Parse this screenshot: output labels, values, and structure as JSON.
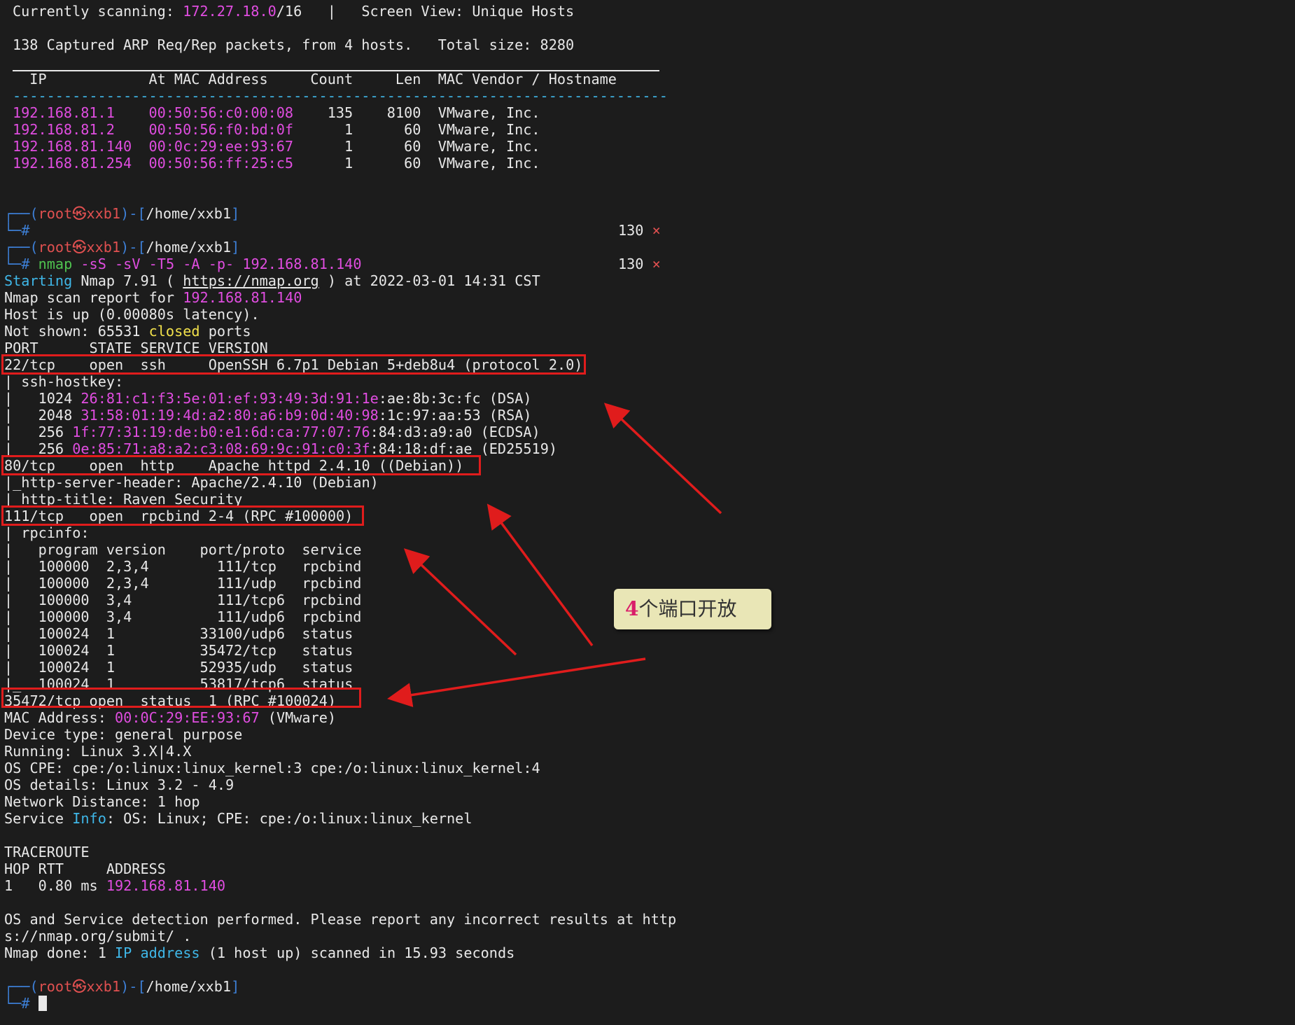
{
  "scan_header": {
    "scanning_label": "Currently scanning: ",
    "scanning_range_ip": "172.27.18.0",
    "scanning_range_mask": "/16",
    "separator": "   |   ",
    "screen_view": "Screen View: Unique Hosts",
    "captured": "138 Captured ARP Req/Rep packets, from 4 hosts.   Total size: 8280"
  },
  "hosts_table": {
    "header": "  IP            At MAC Address     Count     Len  MAC Vendor / Hostname",
    "dashes": "-----------------------------------------------------------------------------",
    "rows": [
      {
        "ip": "192.168.81.1  ",
        "mac": "00:50:56:c0:00:08",
        "rest": "    135    8100  VMware, Inc."
      },
      {
        "ip": "192.168.81.2  ",
        "mac": "00:50:56:f0:bd:0f",
        "rest": "      1      60  VMware, Inc."
      },
      {
        "ip": "192.168.81.140",
        "mac": "00:0c:29:ee:93:67",
        "rest": "      1      60  VMware, Inc."
      },
      {
        "ip": "192.168.81.254",
        "mac": "00:50:56:ff:25:c5",
        "rest": "      1      60  VMware, Inc."
      }
    ]
  },
  "prompt": {
    "corner_top": "┌──",
    "corner_bottom": "└─",
    "open_paren": "(",
    "user": "root",
    "skull": "㉿",
    "host": "xxb1",
    "close_dash": ")-[",
    "path": "/home/xxb1",
    "close_bracket": "]",
    "hash": "#",
    "exit_code": "130",
    "exit_mark": "×"
  },
  "command": {
    "cmd": "nmap",
    "args": "-sS -sV -T5 -A -p- 192.168.81.140"
  },
  "nmap": {
    "starting_pre": "Starting",
    "starting_mid": " Nmap 7.91 ( ",
    "url": "https://nmap.org",
    "starting_post": " ) at 2022-03-01 14:31 CST",
    "report_pre": "Nmap scan report for ",
    "report_ip": "192.168.81.140",
    "host_up": "Host is up (0.00080s latency).",
    "not_shown_pre": "Not shown: 65531 ",
    "not_shown_closed": "closed",
    "not_shown_post": " ports",
    "port_header": "PORT      STATE SERVICE VERSION",
    "port22": "22/tcp    open  ssh     OpenSSH 6.7p1 Debian 5+deb8u4 (protocol 2.0)",
    "hostkey_title": "| ssh-hostkey:",
    "hostkeys": [
      {
        "pre": "|   1024 ",
        "fp": "26:81:c1:f3:5e:01:ef:93:49:3d:91:1e",
        "post": ":ae:8b:3c:fc (DSA)"
      },
      {
        "pre": "|   2048 ",
        "fp": "31:58:01:19:4d:a2:80:a6:b9:0d:40:98",
        "post": ":1c:97:aa:53 (RSA)"
      },
      {
        "pre": "|   256 ",
        "fp": "1f:77:31:19:de:b0:e1:6d:ca:77:07:76",
        "post": ":84:d3:a9:a0 (ECDSA)"
      },
      {
        "pre": "|_  256 ",
        "fp": "0e:85:71:a8:a2:c3:08:69:9c:91:c0:3f",
        "post": ":84:18:df:ae (ED25519)"
      }
    ],
    "port80": "80/tcp    open  http    Apache httpd 2.4.10 ((Debian))",
    "http_header": "|_http-server-header: Apache/2.4.10 (Debian)",
    "http_title": "|_http-title: Raven Security",
    "port111": "111/tcp   open  rpcbind 2-4 (RPC #100000)",
    "rpcinfo_title": "| rpcinfo:",
    "rpc_lines": [
      "|   program version    port/proto  service",
      "|   100000  2,3,4        111/tcp   rpcbind",
      "|   100000  2,3,4        111/udp   rpcbind",
      "|   100000  3,4          111/tcp6  rpcbind",
      "|   100000  3,4          111/udp6  rpcbind",
      "|   100024  1          33100/udp6  status",
      "|   100024  1          35472/tcp   status",
      "|   100024  1          52935/udp   status",
      "|_  100024  1          53817/tcp6  status"
    ],
    "port35472": "35472/tcp open  status  1 (RPC #100024)",
    "mac_pre": "MAC Address: ",
    "mac_val": "00:0C:29:EE:93:67",
    "mac_post": " (VMware)",
    "device_type": "Device type: general purpose",
    "running": "Running: Linux 3.X|4.X",
    "os_cpe": "OS CPE: cpe:/o:linux:linux_kernel:3 cpe:/o:linux:linux_kernel:4",
    "os_details": "OS details: Linux 3.2 - 4.9",
    "net_dist": "Network Distance: 1 hop",
    "service_pre": "Service ",
    "service_info": "Info",
    "service_post": ": OS: Linux; CPE: cpe:/o:linux:linux_kernel",
    "traceroute": "TRACEROUTE",
    "trace_header": "HOP RTT     ADDRESS",
    "trace_pre": "1   0.80 ms ",
    "trace_ip": "192.168.81.140",
    "os_detect_1": "OS and Service detection performed. Please report any incorrect results at http",
    "os_detect_2": "s://nmap.org/submit/ .",
    "done_pre": "Nmap done: 1 ",
    "done_ip": "IP address",
    "done_post": " (1 host up) scanned in 15.93 seconds"
  },
  "callout": {
    "number": "4",
    "text": "个端口开放"
  },
  "colors": {
    "background": "#1c1c1c",
    "magenta": "#e04de0",
    "highlight_red": "#e01c1c",
    "callout_bg": "#e9e6b6"
  }
}
